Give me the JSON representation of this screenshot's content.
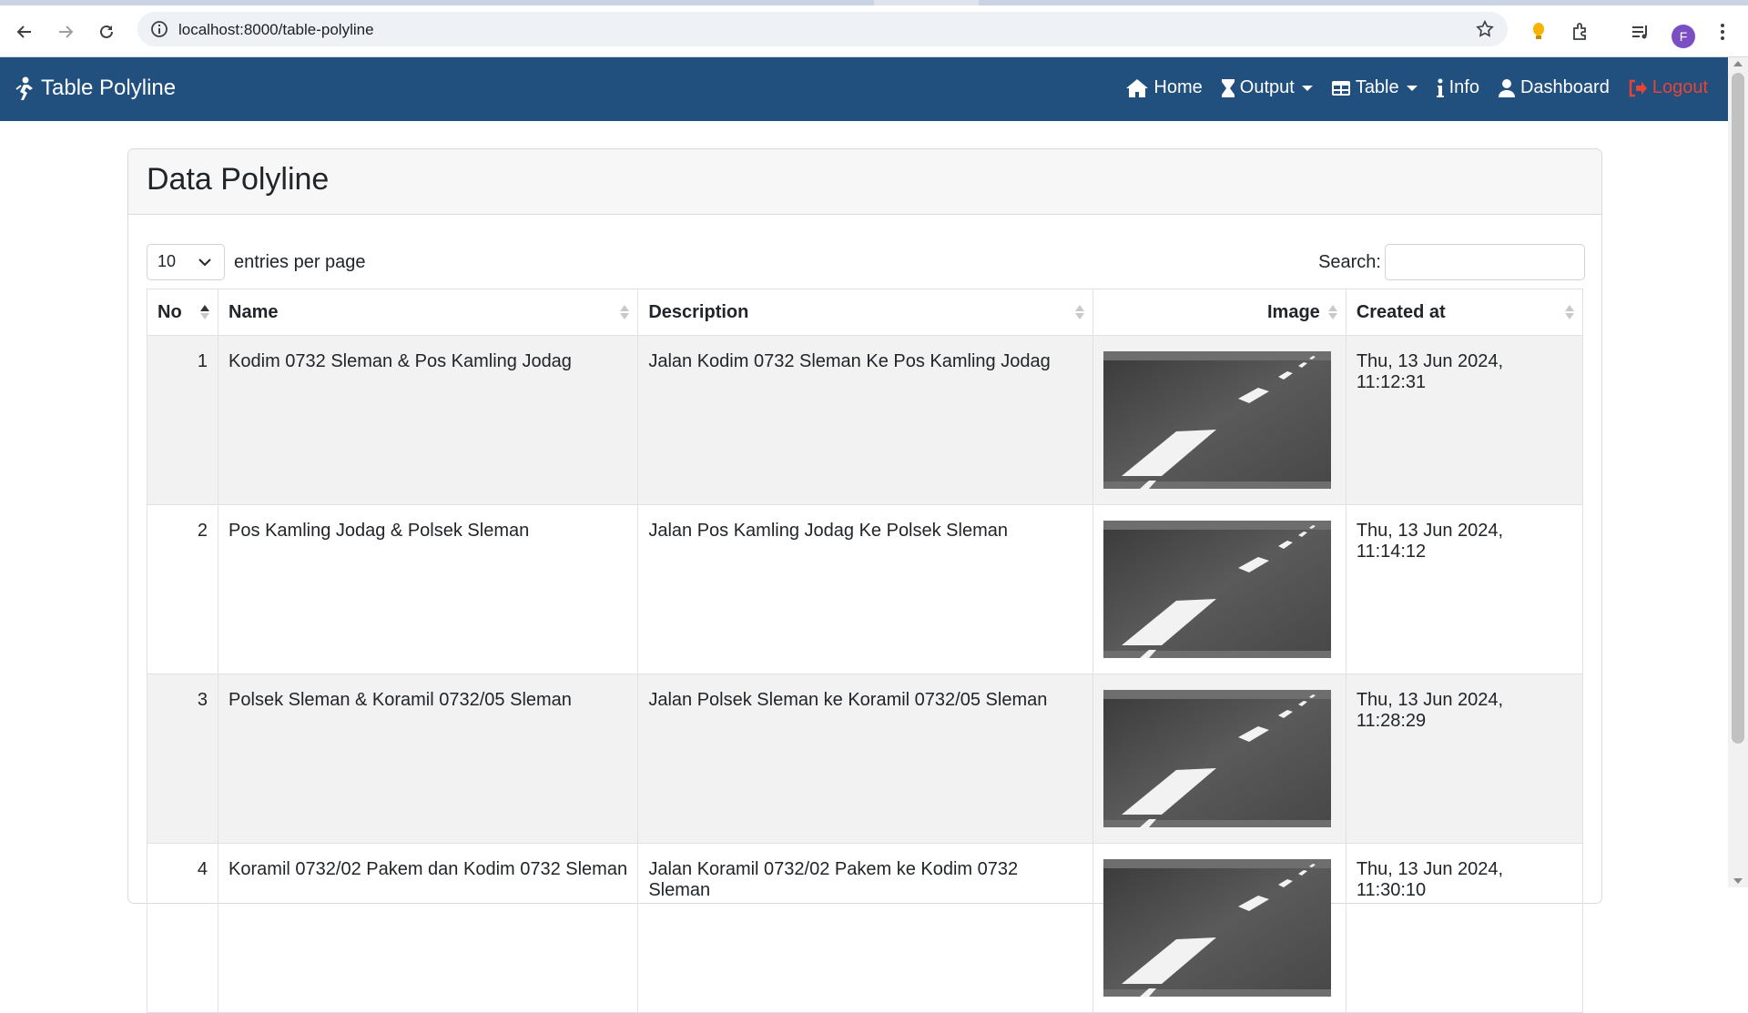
{
  "browser": {
    "url": "localhost:8000/table-polyline",
    "avatar_letter": "F"
  },
  "navbar": {
    "brand": "Table Polyline",
    "items": [
      {
        "label": "Home"
      },
      {
        "label": "Output"
      },
      {
        "label": "Table"
      },
      {
        "label": "Info"
      },
      {
        "label": "Dashboard"
      },
      {
        "label": "Logout"
      }
    ],
    "bg_color": "#21507f",
    "logout_color": "#ea4335"
  },
  "card": {
    "title": "Data Polyline",
    "entries_value": "10",
    "entries_label": "entries per page",
    "search_label": "Search:",
    "search_value": ""
  },
  "table": {
    "headers": [
      "No",
      "Name",
      "Description",
      "Image",
      "Created at"
    ],
    "rows": [
      {
        "no": "1",
        "name": "Kodim 0732 Sleman & Pos Kamling Jodag",
        "description": "Jalan Kodim 0732 Sleman Ke Pos Kamling Jodag",
        "created_at": "Thu, 13 Jun 2024, 11:12:31"
      },
      {
        "no": "2",
        "name": "Pos Kamling Jodag & Polsek Sleman",
        "description": "Jalan Pos Kamling Jodag Ke Polsek Sleman",
        "created_at": "Thu, 13 Jun 2024, 11:14:12"
      },
      {
        "no": "3",
        "name": "Polsek Sleman & Koramil 0732/05 Sleman",
        "description": "Jalan Polsek Sleman ke Koramil 0732/05 Sleman",
        "created_at": "Thu, 13 Jun 2024, 11:28:29"
      },
      {
        "no": "4",
        "name": "Koramil 0732/02 Pakem dan Kodim 0732 Sleman",
        "description": "Jalan Koramil 0732/02 Pakem ke Kodim 0732 Sleman",
        "created_at": "Thu, 13 Jun 2024, 11:30:10"
      }
    ]
  }
}
